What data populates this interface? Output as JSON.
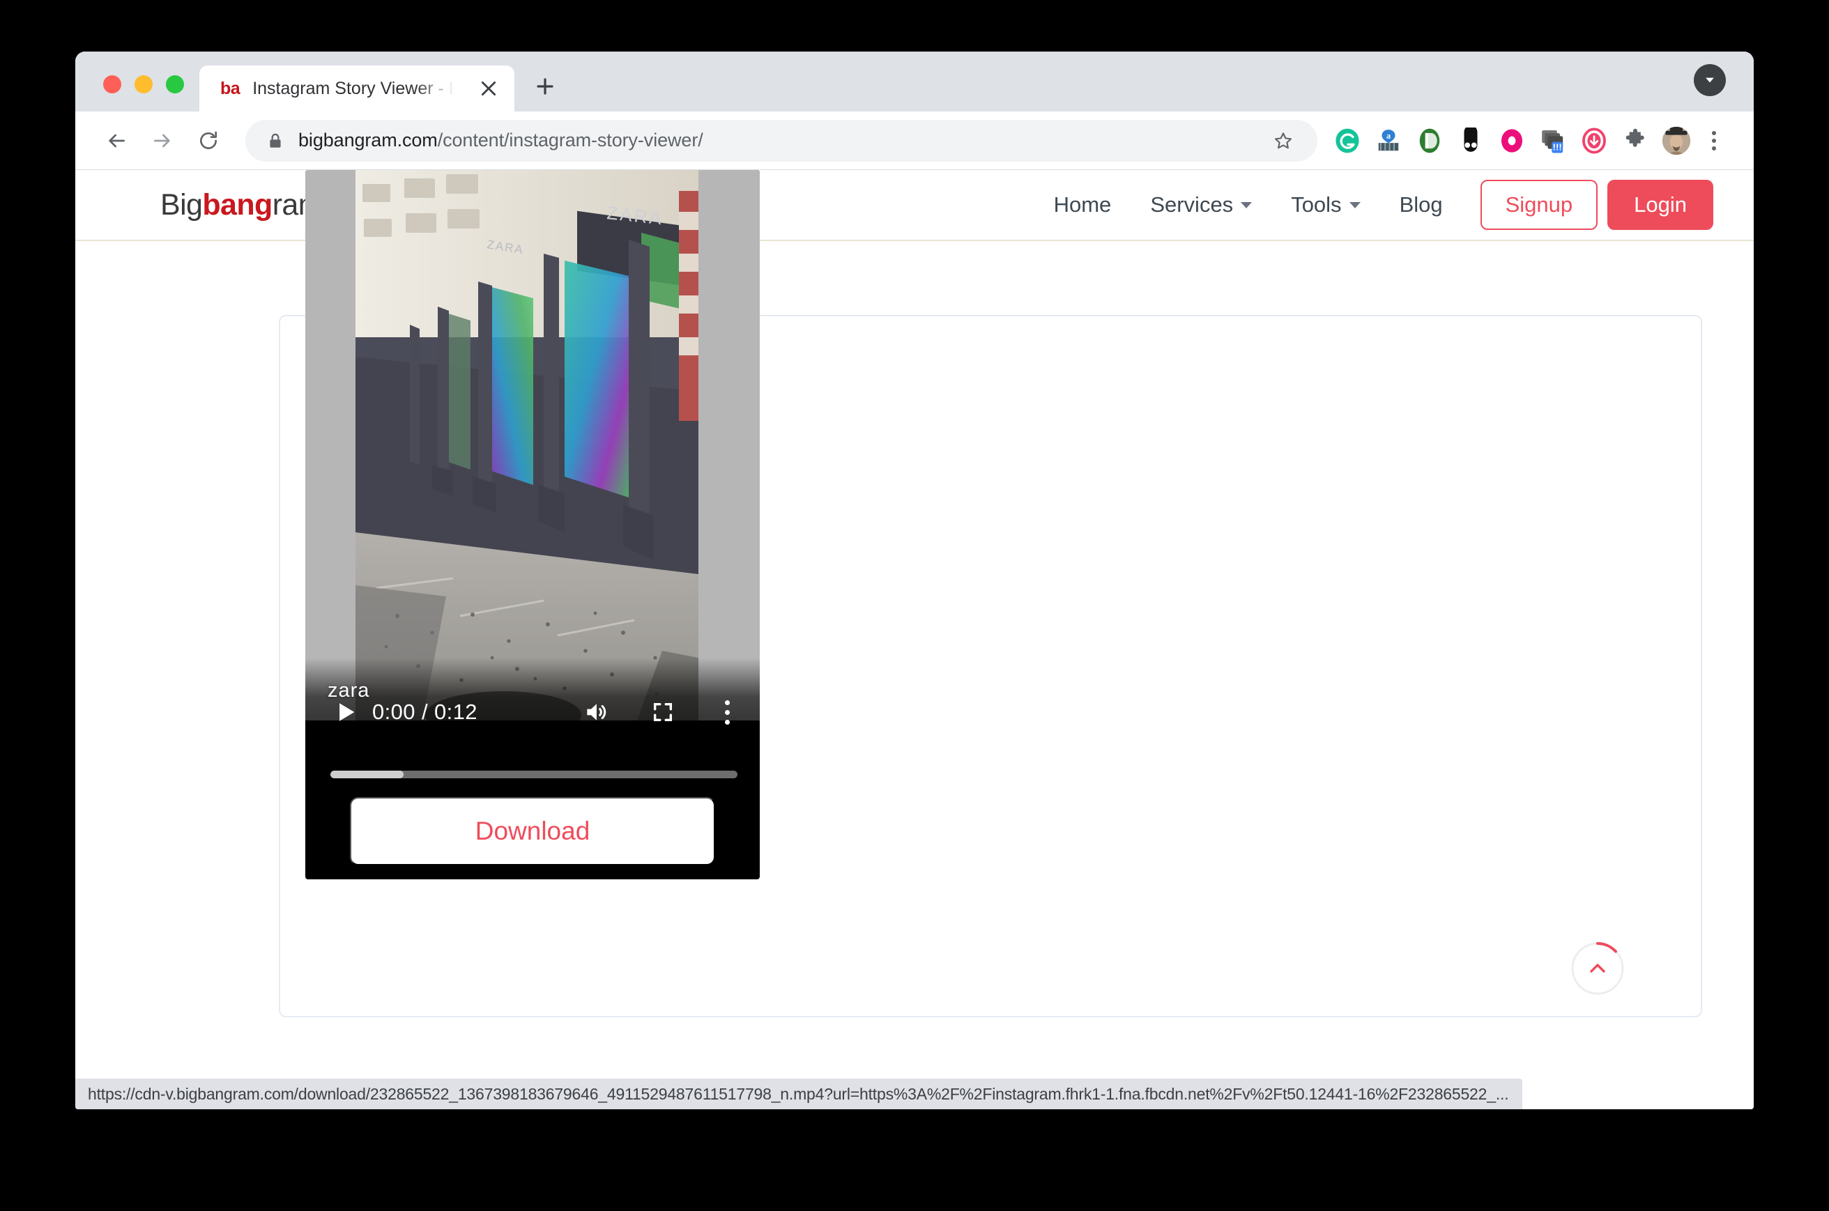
{
  "browser": {
    "tab": {
      "favicon_text": "ba",
      "title": "Instagram Story Viewer - Insta"
    },
    "omnibox": {
      "domain": "bigbangram.com",
      "path": "/content/instagram-story-viewer/"
    },
    "status_bar": {
      "url": "https://cdn-v.bigbangram.com/download/232865522_1367398183679646_4911529487611517798_n.mp4?url=https%3A%2F%2Finstagram.fhrk1-1.fna.fbcdn.net%2Fv%2Ft50.12441-16%2F232865522_..."
    },
    "icons": {
      "back": "back-arrow-icon",
      "forward": "forward-arrow-icon",
      "reload": "reload-icon",
      "lock": "lock-icon",
      "star": "bookmark-star-icon",
      "new_tab": "plus-icon",
      "tab_close": "close-icon",
      "tab_search": "tab-search-chevron-icon",
      "menu": "three-dot-menu-icon"
    },
    "extensions": [
      "grammarly-icon",
      "amazon-assistant-icon",
      "pocket-icon",
      "dark-reader-icon",
      "pink-circle-extension-icon",
      "image-downloader-icon",
      "video-downloader-icon",
      "puzzle-extensions-icon",
      "profile-avatar"
    ]
  },
  "site": {
    "logo": {
      "part1": "Big",
      "part2": "bang",
      "part3": "ram"
    },
    "nav": [
      {
        "label": "Home",
        "has_caret": false
      },
      {
        "label": "Services",
        "has_caret": true
      },
      {
        "label": "Tools",
        "has_caret": true
      },
      {
        "label": "Blog",
        "has_caret": false
      }
    ],
    "signup_label": "Signup",
    "login_label": "Login"
  },
  "player": {
    "time_display": "0:00 / 0:12",
    "current_time": "0:00",
    "duration": "0:12",
    "progress_percent": 18,
    "watermark": "zara",
    "download_label": "Download",
    "controls": {
      "play": "play-icon",
      "volume": "volume-on-icon",
      "fullscreen": "fullscreen-icon",
      "more": "more-options-icon"
    }
  },
  "scroll_top": {
    "icon": "chevron-up-icon",
    "progress_percent": 12
  },
  "colors": {
    "brand_red": "#ee4c5b",
    "logo_red": "#c9181f",
    "header_border": "#e9e5d4",
    "card_border": "#e6eaf2"
  }
}
